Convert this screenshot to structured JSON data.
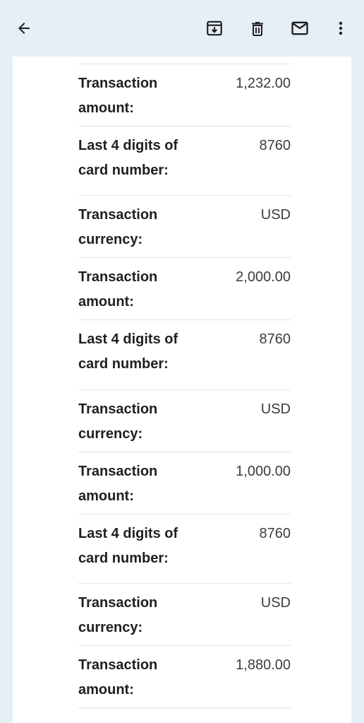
{
  "toolbar": {
    "back_icon": "arrow-back-icon",
    "archive_icon": "archive-icon",
    "delete_icon": "trash-icon",
    "mark_unread_icon": "mail-icon",
    "more_icon": "more-vert-icon",
    "icon_color": "#1f1f1f",
    "background": "#e6eef6"
  },
  "email": {
    "details": [
      {
        "label": "Transaction amount:",
        "value": "1,232.00"
      },
      {
        "label": "Last 4 digits of card number:",
        "value": "8760"
      },
      {
        "label": "Transaction currency:",
        "value": "USD"
      },
      {
        "label": "Transaction amount:",
        "value": "2,000.00"
      },
      {
        "label": "Last 4 digits of card number:",
        "value": "8760"
      },
      {
        "label": "Transaction currency:",
        "value": "USD"
      },
      {
        "label": "Transaction amount:",
        "value": "1,000.00"
      },
      {
        "label": "Last 4 digits of card number:",
        "value": "8760"
      },
      {
        "label": "Transaction currency:",
        "value": "USD"
      },
      {
        "label": "Transaction amount:",
        "value": "1,880.00"
      }
    ]
  }
}
